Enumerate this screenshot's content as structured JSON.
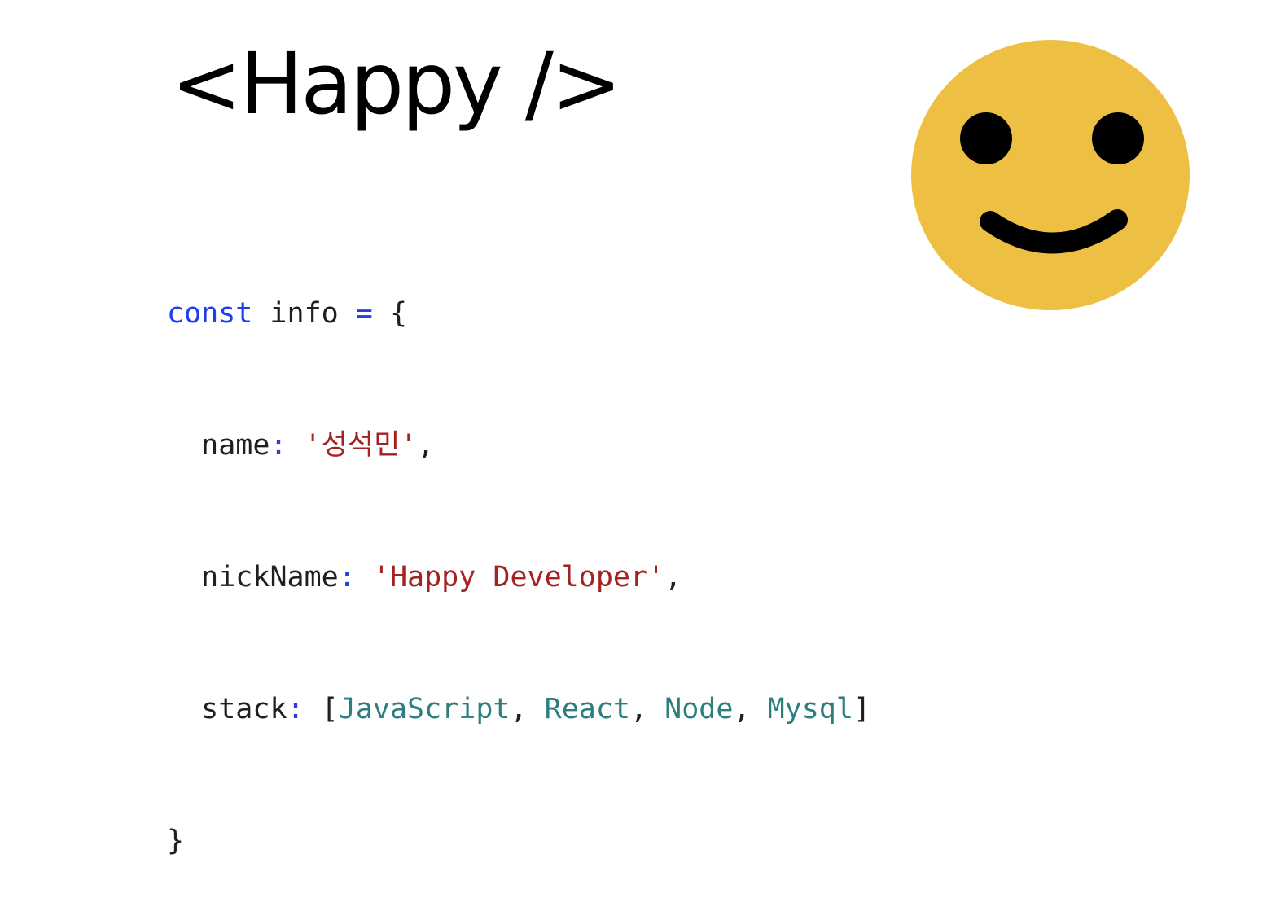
{
  "title": "<Happy />",
  "code": {
    "line1": {
      "keyword": "const",
      "name": " info ",
      "op": "=",
      "brace": " {"
    },
    "line2": {
      "indent": "  ",
      "key": "name",
      "colon": ":",
      "space": " ",
      "value": "'성석민'",
      "comma": ","
    },
    "line3": {
      "indent": "  ",
      "key": "nickName",
      "colon": ":",
      "space": " ",
      "value": "'Happy Developer'",
      "comma": ","
    },
    "line4": {
      "indent": "  ",
      "key": "stack",
      "colon": ":",
      "open": " [",
      "items": [
        "JavaScript",
        "React",
        "Node",
        "Mysql"
      ],
      "sep": ", ",
      "close": "]"
    },
    "line5": {
      "brace": "}"
    }
  },
  "smiley": {
    "icon": "smiley-face-icon",
    "face_color": "#EDC043",
    "feature_color": "#000000"
  },
  "colors": {
    "keyword": "#1C3FF0",
    "string": "#A32222",
    "identifier": "#2D7F7F",
    "text": "#1F1F1F"
  }
}
